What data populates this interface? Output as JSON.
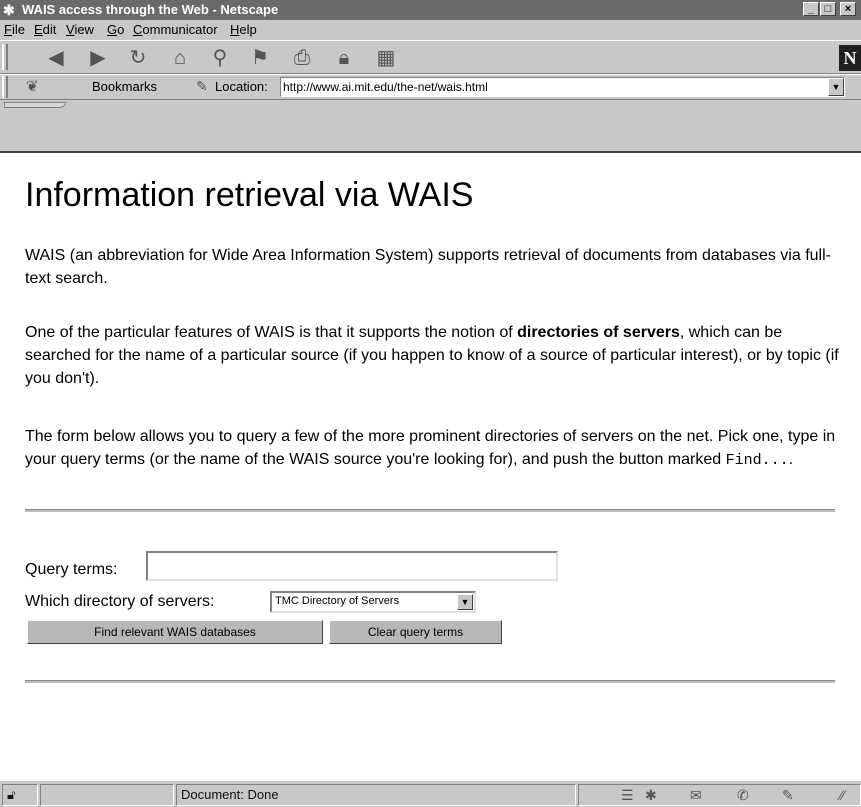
{
  "window": {
    "title": "WAIS access through the Web - Netscape",
    "controls": {
      "minimize": "_",
      "maximize": "□",
      "close": "×"
    }
  },
  "menu": [
    "File",
    "Edit",
    "View",
    "Go",
    "Communicator",
    "Help"
  ],
  "toolbar": {
    "icons": [
      "back-icon",
      "forward-icon",
      "reload-icon",
      "home-icon",
      "search-icon",
      "guide-icon",
      "print-icon",
      "security-icon",
      "stop-icon"
    ],
    "logo": "N"
  },
  "location_bar": {
    "bookmarks_label": "Bookmarks",
    "location_label": "Location:",
    "url": "http://www.ai.mit.edu/the-net/wais.html"
  },
  "page": {
    "heading": "Information retrieval via WAIS",
    "para1": "WAIS (an abbreviation for Wide Area Information System) supports retrieval of documents from databases via full-text search.",
    "para2_pre": "One of the particular features of WAIS is that it supports the notion of ",
    "para2_bold": "directories of servers",
    "para2_post": ", which can be searched for the name of a particular source (if you happen to know of a source of particular interest), or by topic (if you don't).",
    "para3_pre": "The form below allows you to query a few of the more prominent directories of servers on the net. Pick one, type in your query terms (or the name of the WAIS source you're looking for), and push the button marked ",
    "para3_code": "Find...",
    "para3_post": ".",
    "form": {
      "query_label": "Query terms:",
      "query_value": "",
      "directory_label": "Which directory of servers:",
      "directory_selected": "TMC Directory of Servers",
      "find_button": "Find relevant WAIS databases",
      "clear_button": "Clear query terms"
    }
  },
  "status": {
    "text": "Document: Done"
  }
}
